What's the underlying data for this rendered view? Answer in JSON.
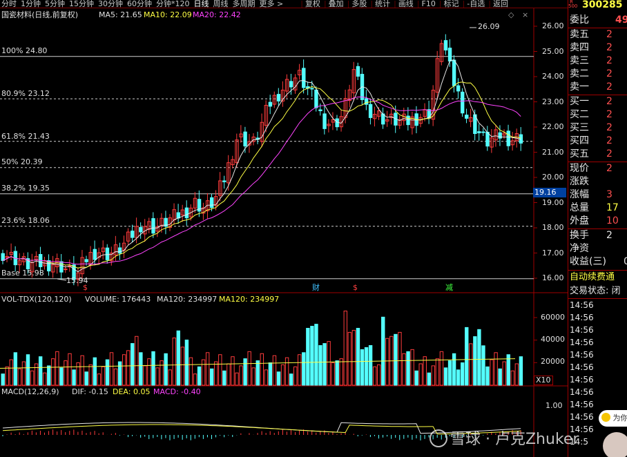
{
  "tabs": [
    "分时",
    "1分钟",
    "5分钟",
    "15分钟",
    "30分钟",
    "60分钟",
    "分钟*120",
    "日线",
    "周线",
    "多周期",
    "更多 >"
  ],
  "active_tab": "日线",
  "tools": [
    "复权",
    "叠加",
    "多股",
    "统计",
    "画线",
    "F10",
    "标记",
    "-自选",
    "返回"
  ],
  "main": {
    "title": "国瓷材料(日线,前复权)",
    "ma5": "MA5: 21.65",
    "ma10": "MA10: 22.09",
    "ma20": "MA20: 22.42",
    "fib": [
      "100% 24.80",
      "80.9% 23.12",
      "61.8% 21.43",
      "50% 20.39",
      "38.2% 19.35",
      "23.6% 18.06",
      "Base 15.98"
    ],
    "price_axis": [
      "26.00",
      "25.00",
      "24.00",
      "23.00",
      "22.00",
      "21.00",
      "20.00",
      "19.00",
      "18.00",
      "17.00",
      "16.00"
    ],
    "current_price": "19.16",
    "high_label": "26.09",
    "low_label": "15.94",
    "markers": [
      "$",
      "财",
      "$",
      "减"
    ],
    "up_color": "#ff3c3c",
    "down_color": "#54ffff"
  },
  "vol": {
    "title": "VOL-TDX(120,120)",
    "volume": "VOLUME: 176443",
    "ma120a": "MA120: 234997",
    "ma120b": "MA120: 234997",
    "axis": [
      "60000",
      "40000",
      "20000"
    ],
    "unit": "X10"
  },
  "macd": {
    "title": "MACD(12,26,9)",
    "dif": "DIF: -0.15",
    "dea": "DEA: 0.05",
    "macd": "MACD: -0.40",
    "axis": [
      "1.00"
    ]
  },
  "orderbook": {
    "code": "300285",
    "r_label": "R",
    "r_sub": "500",
    "wei_bi": "委比",
    "wei_bi_val": "49",
    "sell": [
      "卖五",
      "卖四",
      "卖三",
      "卖二",
      "卖一"
    ],
    "buy": [
      "买一",
      "买二",
      "买三",
      "买四",
      "买五"
    ],
    "sell_vals": [
      "2",
      "2",
      "2",
      "2",
      "2"
    ],
    "buy_vals": [
      "2",
      "2",
      "2",
      "2",
      "2"
    ],
    "stats": [
      "现价",
      "涨跌",
      "涨幅",
      "总量",
      "外盘"
    ],
    "stats_vals": [
      "2",
      "",
      "3",
      "17",
      "10"
    ],
    "stats2": [
      "换手",
      "净资",
      "收益(三)"
    ],
    "stats2_vals": [
      "2",
      "",
      "0"
    ],
    "notice": "自动续费通",
    "status": "交易状态: 闭",
    "ticks": [
      "14:56",
      "14:56",
      "14:56",
      "14:56",
      "14:56",
      "14:56",
      "14:56",
      "14:56",
      "14:56",
      "14:56",
      "14:56",
      "14:5"
    ]
  },
  "watermark": "雪球 · 卢克Zhuker",
  "chat_label": "为你"
}
